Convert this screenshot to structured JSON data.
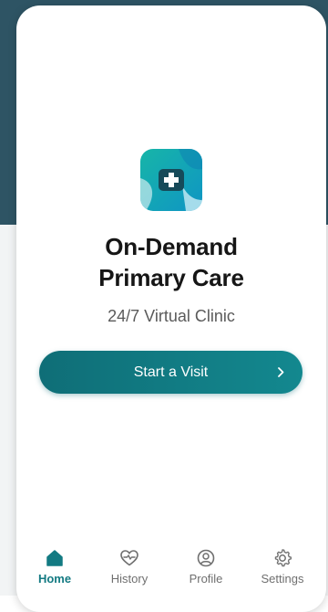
{
  "app": {
    "title_line1": "On-Demand",
    "title_line2": "Primary Care",
    "subtitle": "24/7 Virtual Clinic"
  },
  "primary_action": {
    "label": "Start a Visit",
    "chevron": "chevron-right-icon"
  },
  "tabs": [
    {
      "label": "Home",
      "icon": "home-icon",
      "active": true
    },
    {
      "label": "History",
      "icon": "heart-icon",
      "active": false
    },
    {
      "label": "Profile",
      "icon": "user-circle-icon",
      "active": false
    },
    {
      "label": "Settings",
      "icon": "gear-icon",
      "active": false
    }
  ],
  "colors": {
    "header_background": "#2e5464",
    "accent": "#137a82",
    "button_gradient_start": "#0f6e77",
    "button_gradient_end": "#13888f",
    "inactive_tab": "#6f6f6f"
  }
}
